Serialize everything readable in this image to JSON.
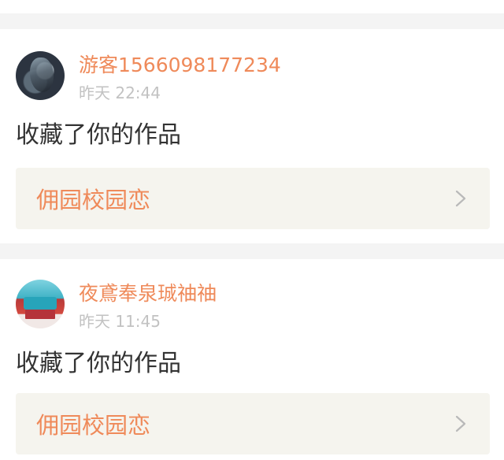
{
  "notifications": [
    {
      "username": "游客1566098177234",
      "timestamp": "昨天 22:44",
      "action": "收藏了你的作品",
      "work_title": "佣园校园恋",
      "avatar_icon": "user-avatar-icon"
    },
    {
      "username": "夜鳶奉泉珹䄂䄂",
      "timestamp": "昨天 11:45",
      "action": "收藏了你的作品",
      "work_title": "佣园校园恋",
      "avatar_icon": "user-avatar-icon"
    }
  ],
  "colors": {
    "accent": "#ef8a5a",
    "timestamp": "#c2c2c2",
    "body_text": "#333333",
    "link_card_bg": "#f5f4ee",
    "divider_bg": "#f4f4f4"
  },
  "icons": {
    "chevron": "chevron-right-icon"
  }
}
